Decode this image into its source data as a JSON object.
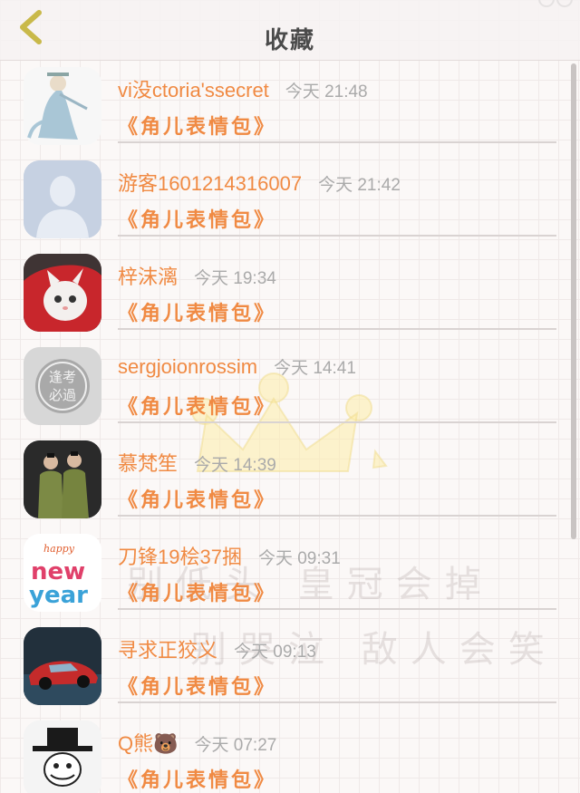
{
  "header": {
    "title": "收藏",
    "back_icon": "chevron-left-icon"
  },
  "favorites": [
    {
      "name": "vi没ctoria'ssecret",
      "time": "今天 21:48",
      "message": "《角儿表情包》",
      "avatar_icon": "fairy-figure-avatar"
    },
    {
      "name": "游客1601214316007",
      "time": "今天 21:42",
      "message": "《角儿表情包》",
      "avatar_icon": "default-person-avatar"
    },
    {
      "name": "梓沫漓",
      "time": "今天 19:34",
      "message": "《角儿表情包》",
      "avatar_icon": "cat-avatar"
    },
    {
      "name": "sergjoionrossim",
      "time": "今天 14:41",
      "message": "《角儿表情包》",
      "avatar_icon": "stamp-avatar",
      "avatar_text": [
        "逢考",
        "必過"
      ]
    },
    {
      "name": "慕梵笙",
      "time": "今天 14:39",
      "message": "《角儿表情包》",
      "avatar_icon": "two-people-avatar"
    },
    {
      "name": "刀锋19桧37捆",
      "time": "今天 09:31",
      "message": "《角儿表情包》",
      "avatar_icon": "happy-new-year-avatar",
      "avatar_text": [
        "happy",
        "new",
        "year"
      ]
    },
    {
      "name": "寻求正狡义",
      "time": "今天 09:13",
      "message": "《角儿表情包》",
      "avatar_icon": "car-avatar"
    },
    {
      "name": "Q熊🐻",
      "time": "今天 07:27",
      "message": "《角儿表情包》",
      "avatar_icon": "hat-figure-avatar"
    }
  ],
  "watermark": {
    "line1": "别低头 皇冠会掉",
    "line2": "别哭泣 敌人会笑",
    "icon": "crown-icon"
  },
  "colors": {
    "accent": "#f08a43",
    "time": "#aaaaaa",
    "title": "#4b4b4b"
  }
}
